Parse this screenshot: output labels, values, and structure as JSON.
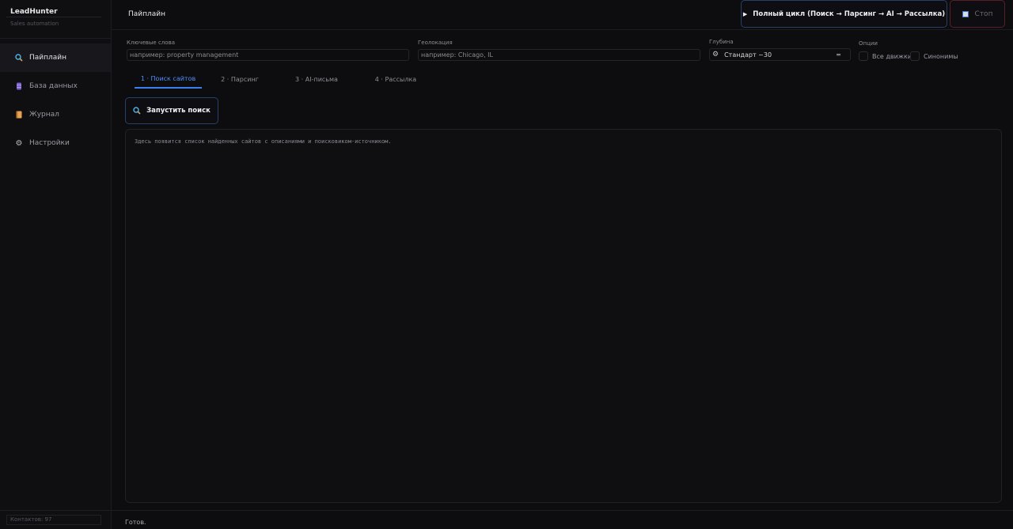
{
  "app": {
    "name": "LeadHunter",
    "subtitle": "Sales automation",
    "contacts_label": "Контактов: 97"
  },
  "sidebar": {
    "items": [
      {
        "label": "Пайплайн",
        "icon": "search-icon",
        "active": true
      },
      {
        "label": "База данных",
        "icon": "database-icon",
        "active": false
      },
      {
        "label": "Журнал",
        "icon": "journal-icon",
        "active": false
      },
      {
        "label": "Настройки",
        "icon": "gear-icon",
        "active": false
      }
    ]
  },
  "header": {
    "title": "Пайплайн",
    "full_cycle_label": "Полный цикл  (Поиск → Парсинг → AI → Рассылка)",
    "stop_label": "Стоп"
  },
  "form": {
    "keywords": {
      "label": "Ключевые слова",
      "placeholder": "например: property management",
      "value": ""
    },
    "geo": {
      "label": "Геолокация",
      "placeholder": "например: Chicago, IL",
      "value": ""
    },
    "depth": {
      "label": "Глубина",
      "value": "Стандарт  ~30"
    },
    "options": {
      "label": "Опции",
      "all_engines": {
        "label": "Все движки",
        "checked": false
      },
      "synonyms": {
        "label": "Синонимы",
        "checked": false
      }
    }
  },
  "tabs": [
    {
      "label": "1 · Поиск сайтов",
      "active": true
    },
    {
      "label": "2 · Парсинг",
      "active": false
    },
    {
      "label": "3 · AI-письма",
      "active": false
    },
    {
      "label": "4 · Рассылка",
      "active": false
    }
  ],
  "main": {
    "run_search_label": "Запустить поиск",
    "results_placeholder": "Здесь появится список найденных сайтов с описаниями и поисковиком-источником."
  },
  "status": {
    "text": "Готов."
  },
  "colors": {
    "background": "#0d0d10",
    "accent": "#3c7ff0",
    "stop_border": "#5a1f26"
  }
}
